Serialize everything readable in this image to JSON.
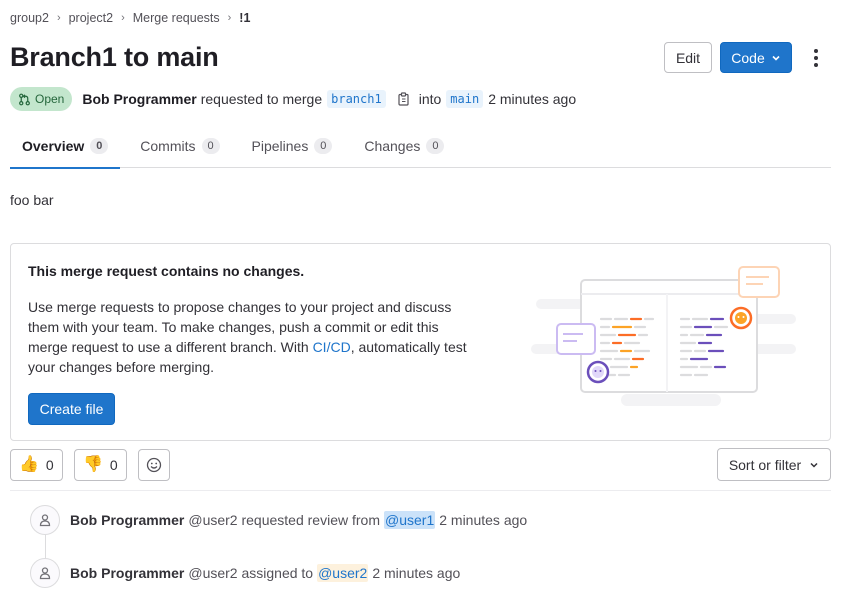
{
  "breadcrumb": [
    "group2",
    "project2",
    "Merge requests",
    "!1"
  ],
  "title": "Branch1 to main",
  "actions": {
    "edit_label": "Edit",
    "code_label": "Code"
  },
  "meta": {
    "status": "Open",
    "author": "Bob Programmer",
    "text_requested": "requested to merge",
    "source_branch": "branch1",
    "text_into": "into",
    "target_branch": "main",
    "time": "2 minutes ago"
  },
  "tabs": [
    {
      "label": "Overview",
      "count": "0"
    },
    {
      "label": "Commits",
      "count": "0"
    },
    {
      "label": "Pipelines",
      "count": "0"
    },
    {
      "label": "Changes",
      "count": "0"
    }
  ],
  "description": "foo bar",
  "empty_state": {
    "heading": "This merge request contains no changes.",
    "body_before_link": "Use merge requests to propose changes to your project and discuss them with your team. To make changes, push a commit or edit this merge request to use a different branch. With ",
    "link_text": "CI/CD",
    "body_after_link": ", automatically test your changes before merging.",
    "button": "Create file"
  },
  "reactions": {
    "thumbs_up": "0",
    "thumbs_down": "0"
  },
  "sort_label": "Sort or filter",
  "timeline": [
    {
      "author": "Bob Programmer",
      "username": "@user2",
      "action": "requested review from",
      "mention": "@user1",
      "time": "2 minutes ago"
    },
    {
      "author": "Bob Programmer",
      "username": "@user2",
      "action": "assigned to",
      "mention": "@user2",
      "time": "2 minutes ago"
    }
  ],
  "colors": {
    "primary": "#1f75cb",
    "open_badge_bg": "#c3e6cd",
    "open_badge_text": "#24663b",
    "illustration_orange": "#fc6d26",
    "illustration_purple": "#6b4fbb"
  }
}
